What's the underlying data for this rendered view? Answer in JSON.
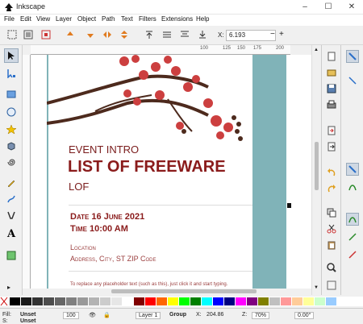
{
  "window": {
    "title": "Inkscape",
    "minimize": "–",
    "maximize": "☐",
    "close": "✕"
  },
  "menu": [
    "File",
    "Edit",
    "View",
    "Layer",
    "Object",
    "Path",
    "Text",
    "Filters",
    "Extensions",
    "Help"
  ],
  "toolbar": {
    "x_label": "X:",
    "x_value": "6.193",
    "minus": "−",
    "plus": "+"
  },
  "ruler": {
    "h_ticks": [
      "100",
      "125",
      "150",
      "175",
      "200"
    ],
    "v_ticks": [
      "1",
      "2",
      "3",
      "4",
      "5",
      "6",
      "7",
      "8",
      "9"
    ]
  },
  "document": {
    "event_intro": "EVENT INTRO",
    "headline": "LIST OF FREEWARE",
    "sub": "LOF",
    "date": "Date 16 June 2021",
    "time": "Time 10:00 AM",
    "location_label": "Location",
    "address": "Address, City, ST ZIP Code",
    "placeholder_hint": "To replace any placeholder text (such as this), just click it and start typing."
  },
  "palette_colors": [
    "#000000",
    "#1a1a1a",
    "#333333",
    "#4d4d4d",
    "#666666",
    "#808080",
    "#999999",
    "#b3b3b3",
    "#cccccc",
    "#e6e6e6",
    "#ffffff",
    "#800000",
    "#ff0000",
    "#ff6600",
    "#ffff00",
    "#00ff00",
    "#008000",
    "#00ffff",
    "#0000ff",
    "#000080",
    "#ff00ff",
    "#800080",
    "#808000",
    "#c0c0c0",
    "#ff9999",
    "#ffcc99",
    "#ffff99",
    "#ccffcc",
    "#99ccff"
  ],
  "status": {
    "fill_label": "Fill:",
    "fill_value": "Unset",
    "stroke_label": "S:",
    "stroke_value": "Unset",
    "opacity": "100",
    "layer": "Layer 1",
    "object_type": "Group",
    "x_label": "X:",
    "x_value": "204.86",
    "zoom_label": "Z:",
    "zoom_value": "70%",
    "rotation": "0.00°"
  },
  "colors": {
    "accent": "#7a1c1c",
    "teal": "#80b3b8",
    "blossom": "#cc3f3f",
    "branch": "#4d2a1d"
  }
}
